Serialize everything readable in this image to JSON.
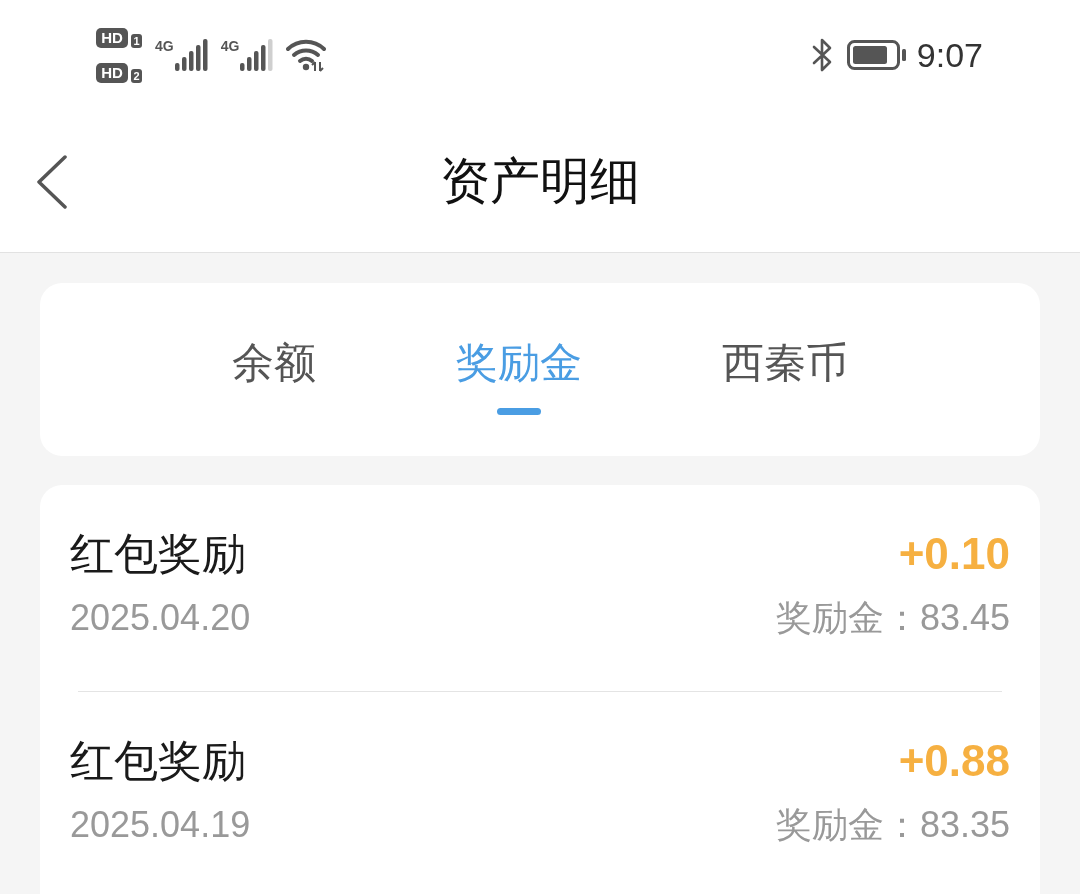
{
  "status_bar": {
    "sims": [
      {
        "badge": "HD",
        "slot": "1"
      },
      {
        "badge": "HD",
        "slot": "2"
      }
    ],
    "networks": [
      {
        "label": "4G"
      },
      {
        "label": "4G"
      }
    ],
    "time": "9:07"
  },
  "header": {
    "title": "资产明细"
  },
  "tabs": [
    {
      "label": "余额",
      "selected": false
    },
    {
      "label": "奖励金",
      "selected": true
    },
    {
      "label": "西秦币",
      "selected": false
    }
  ],
  "records": [
    {
      "title": "红包奖励",
      "date": "2025.04.20",
      "amount": "+0.10",
      "balance": "奖励金：83.45"
    },
    {
      "title": "红包奖励",
      "date": "2025.04.19",
      "amount": "+0.88",
      "balance": "奖励金：83.35"
    }
  ]
}
